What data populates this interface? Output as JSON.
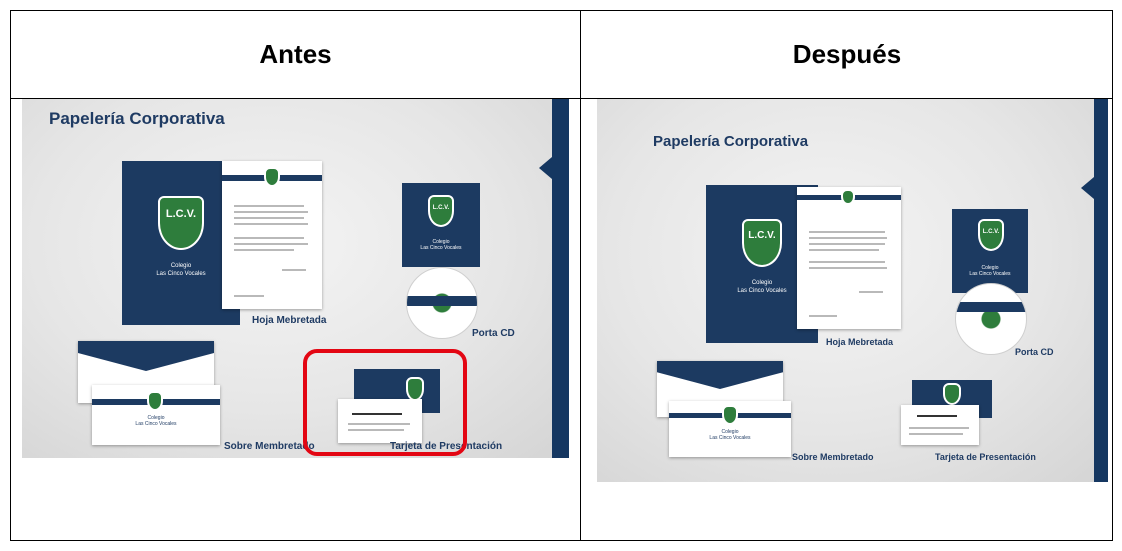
{
  "table": {
    "headers": {
      "left": "Antes",
      "right": "Después"
    }
  },
  "slide": {
    "title": "Papelería Corporativa",
    "captions": {
      "hoja": "Hoja Mebretada",
      "porta_cd": "Porta CD",
      "sobre": "Sobre Membretado",
      "tarjeta": "Tarjeta de Presentación"
    },
    "logo": {
      "top": "Colegio",
      "main": "L.C.V."
    },
    "school": {
      "line1": "Colegio",
      "line2": "Las Cinco Vocales"
    }
  },
  "colors": {
    "navy": "#1c3a61",
    "green": "#2e7d3c",
    "highlight": "#e30613"
  }
}
